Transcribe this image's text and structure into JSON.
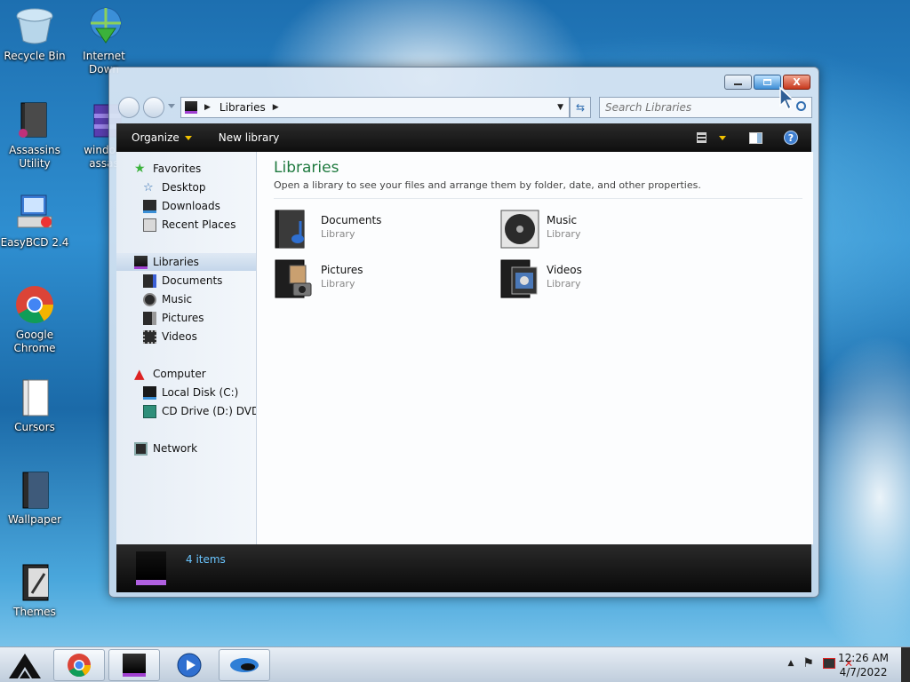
{
  "desktop": {
    "icons": [
      {
        "label": "Recycle Bin"
      },
      {
        "label": "Internet Down"
      },
      {
        "label": "Assassins Utility"
      },
      {
        "label": "window assas"
      },
      {
        "label": "EasyBCD 2.4"
      },
      {
        "label": "Google Chrome"
      },
      {
        "label": "Cursors"
      },
      {
        "label": "Wallpaper"
      },
      {
        "label": "Themes"
      }
    ]
  },
  "window": {
    "controls": {
      "minimize": "minimize",
      "maximize": "maximize",
      "close": "X"
    },
    "address": {
      "crumb": "Libraries"
    },
    "search": {
      "placeholder": "Search Libraries"
    },
    "toolbar": {
      "organize": "Organize",
      "new_library": "New library"
    },
    "nav": {
      "favorites": "Favorites",
      "desktop": "Desktop",
      "downloads": "Downloads",
      "recent": "Recent Places",
      "libraries": "Libraries",
      "documents": "Documents",
      "music": "Music",
      "pictures": "Pictures",
      "videos": "Videos",
      "computer": "Computer",
      "local_disk": "Local Disk (C:)",
      "cd_drive": "CD Drive (D:) DVD_",
      "network": "Network"
    },
    "content": {
      "title": "Libraries",
      "description": "Open a library to see your files and arrange them by folder, date, and other properties.",
      "libraries": [
        {
          "name": "Documents",
          "type": "Library"
        },
        {
          "name": "Music",
          "type": "Library"
        },
        {
          "name": "Pictures",
          "type": "Library"
        },
        {
          "name": "Videos",
          "type": "Library"
        }
      ]
    },
    "details": {
      "count": "4 items"
    }
  },
  "taskbar": {
    "clock": {
      "time": "12:26 AM",
      "date": "4/7/2022"
    }
  },
  "colors": {
    "accent_green": "#1f7a3f",
    "detail_text": "#6ac5ff",
    "toolbar_bg": "#111111"
  }
}
